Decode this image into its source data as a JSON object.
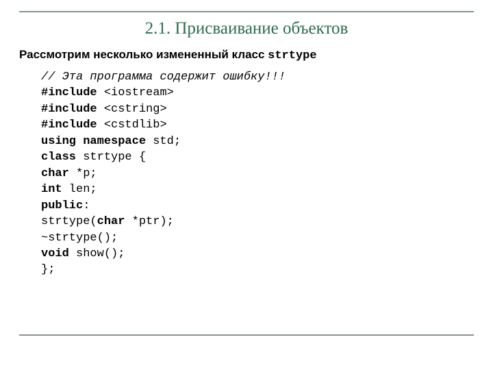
{
  "title": "2.1. Присваивание объектов",
  "intro": {
    "prefix": "Рассмотрим несколько измененный класс ",
    "classname": "strtype"
  },
  "code": {
    "comment": "// Эта программа содержит ошибку!!!",
    "lines": [
      {
        "kw": "#include",
        "rest": " <iostream>"
      },
      {
        "kw": "#include",
        "rest": " <cstring>"
      },
      {
        "kw": "#include",
        "rest": " <cstdlib>"
      },
      {
        "plain_parts": [
          [
            "kw",
            "using namespace"
          ],
          [
            "txt",
            " std;"
          ]
        ]
      },
      {
        "plain_parts": [
          [
            "kw",
            "class"
          ],
          [
            "txt",
            " strtype {"
          ]
        ]
      },
      {
        "plain_parts": [
          [
            "kw",
            "char"
          ],
          [
            "txt",
            " *p;"
          ]
        ]
      },
      {
        "plain_parts": [
          [
            "kw",
            "int"
          ],
          [
            "txt",
            " len;"
          ]
        ]
      },
      {
        "plain_parts": [
          [
            "kw",
            "public"
          ],
          [
            "txt",
            ":"
          ]
        ]
      },
      {
        "plain_parts": [
          [
            "txt",
            "strtype("
          ],
          [
            "kw",
            "char"
          ],
          [
            "txt",
            " *ptr);"
          ]
        ]
      },
      {
        "plain_parts": [
          [
            "txt",
            "~strtype();"
          ]
        ]
      },
      {
        "plain_parts": [
          [
            "kw",
            "void"
          ],
          [
            "txt",
            " show();"
          ]
        ]
      },
      {
        "plain_parts": [
          [
            "txt",
            "};"
          ]
        ]
      }
    ]
  }
}
